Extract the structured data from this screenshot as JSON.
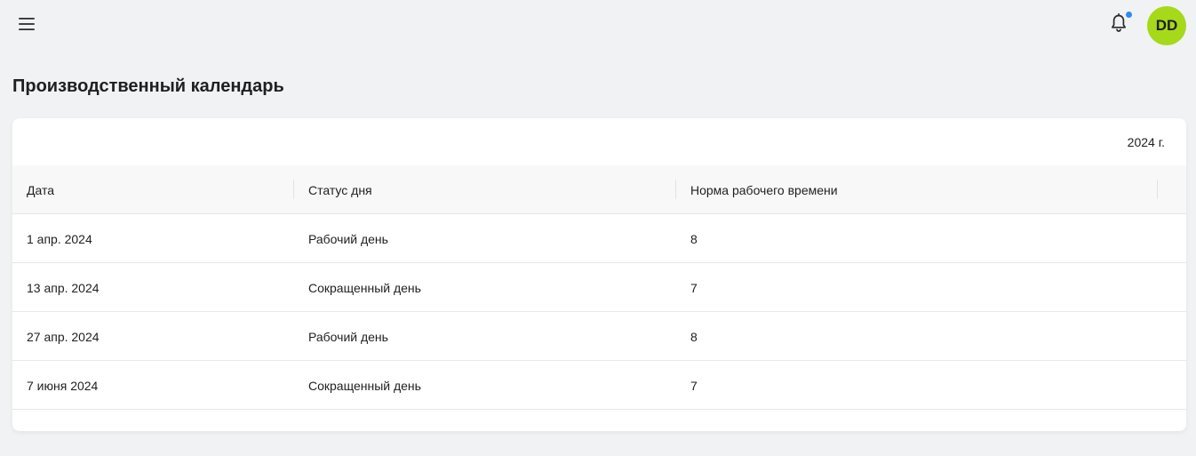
{
  "header": {
    "menu_icon": "hamburger-menu-icon",
    "bell_icon": "bell-icon",
    "notification_dot_color": "#2b8cf2",
    "avatar_initials": "DD",
    "avatar_color": "#a5d91a"
  },
  "page": {
    "title": "Производственный календарь"
  },
  "calendar": {
    "year_label": "2024 г.",
    "columns": [
      "Дата",
      "Статус дня",
      "Норма рабочего времени"
    ],
    "rows": [
      {
        "date": "1 апр. 2024",
        "status": "Рабочий день",
        "hours": "8"
      },
      {
        "date": "13 апр. 2024",
        "status": "Сокращенный день",
        "hours": "7"
      },
      {
        "date": "27 апр. 2024",
        "status": "Рабочий день",
        "hours": "8"
      },
      {
        "date": "7 июня 2024",
        "status": "Сокращенный день",
        "hours": "7"
      }
    ]
  }
}
